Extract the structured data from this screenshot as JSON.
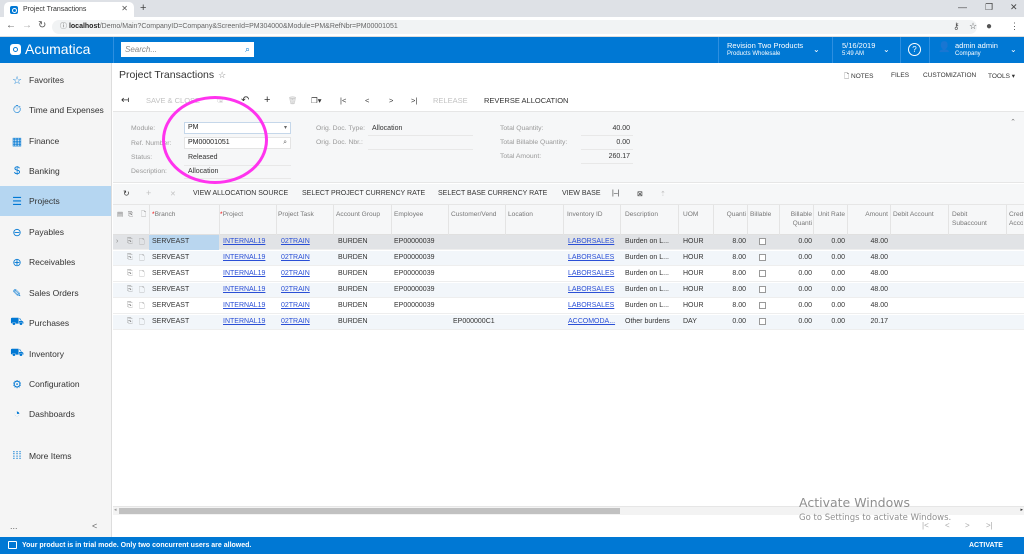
{
  "browser": {
    "tab_title": "Project Transactions",
    "url_host": "localhost",
    "url_path": "/Demo/Main?CompanyID=Company&ScreenId=PM304000&Module=PM&RefNbr=PM00001051"
  },
  "header": {
    "logo": "Acumatica",
    "search_placeholder": "Search...",
    "branch_name": "Revision Two Products",
    "branch_sub": "Products Wholesale",
    "date": "5/16/2019",
    "time": "5:49 AM",
    "user_name": "admin admin",
    "user_company": "Company"
  },
  "sidebar": {
    "items": [
      {
        "label": "Favorites",
        "icon": "star-icon"
      },
      {
        "label": "Time and Expenses",
        "icon": "stopwatch-icon"
      },
      {
        "label": "Finance",
        "icon": "calculator-icon"
      },
      {
        "label": "Banking",
        "icon": "dollar-icon"
      },
      {
        "label": "Projects",
        "icon": "projects-icon",
        "active": true
      },
      {
        "label": "Payables",
        "icon": "minus-circle-icon"
      },
      {
        "label": "Receivables",
        "icon": "plus-circle-icon"
      },
      {
        "label": "Sales Orders",
        "icon": "edit-icon"
      },
      {
        "label": "Purchases",
        "icon": "cart-icon"
      },
      {
        "label": "Inventory",
        "icon": "truck-icon"
      },
      {
        "label": "Configuration",
        "icon": "gear-icon"
      },
      {
        "label": "Dashboards",
        "icon": "gauge-icon"
      },
      {
        "label": "More Items",
        "icon": "grid-dots-icon"
      }
    ],
    "more": "...",
    "collapse": "<"
  },
  "page": {
    "title": "Project Transactions",
    "top_links": {
      "notes": "NOTES",
      "files": "FILES",
      "customization": "CUSTOMIZATION",
      "tools": "TOOLS"
    },
    "toolbar": {
      "save_close": "SAVE & CLOSE",
      "release": "RELEASE",
      "reverse_allocation": "REVERSE ALLOCATION"
    },
    "form": {
      "module_label": "Module:",
      "module_value": "PM",
      "ref_label": "Ref. Number:",
      "ref_value": "PM00001051",
      "status_label": "Status:",
      "status_value": "Released",
      "desc_label": "Description:",
      "desc_value": "Allocation",
      "orig_type_label": "Orig. Doc. Type:",
      "orig_type_value": "Allocation",
      "orig_nbr_label": "Orig. Doc. Nbr.:",
      "orig_nbr_value": "",
      "total_qty_label": "Total Quantity:",
      "total_qty_value": "40.00",
      "total_bill_qty_label": "Total Billable Quantity:",
      "total_bill_qty_value": "0.00",
      "total_amount_label": "Total Amount:",
      "total_amount_value": "260.17"
    },
    "grid_toolbar": {
      "view_alloc": "VIEW ALLOCATION SOURCE",
      "sel_proj_rate": "SELECT PROJECT CURRENCY RATE",
      "sel_base_rate": "SELECT BASE CURRENCY RATE",
      "view_base": "VIEW BASE"
    }
  },
  "grid": {
    "columns": [
      "Branch",
      "Project",
      "Project Task",
      "Account Group",
      "Employee",
      "Customer/Vend",
      "Location",
      "Inventory ID",
      "Description",
      "UOM",
      "Quanti",
      "Billable",
      "Billable Quanti",
      "Unit Rate",
      "Amount",
      "Debit Account",
      "Debit Subaccount",
      "Cred Acco"
    ],
    "rows": [
      {
        "branch": "SERVEAST",
        "project": "INTERNAL19",
        "task": "02TRAIN",
        "acct_group": "BURDEN",
        "employee": "EP00000039",
        "customer": "",
        "location": "",
        "inventory": "LABORSALES",
        "description": "Burden on L...",
        "uom": "HOUR",
        "qty": "8.00",
        "billable": false,
        "bill_qty": "0.00",
        "unit_rate": "0.00",
        "amount": "48.00"
      },
      {
        "branch": "SERVEAST",
        "project": "INTERNAL19",
        "task": "02TRAIN",
        "acct_group": "BURDEN",
        "employee": "EP00000039",
        "customer": "",
        "location": "",
        "inventory": "LABORSALES",
        "description": "Burden on L...",
        "uom": "HOUR",
        "qty": "8.00",
        "billable": false,
        "bill_qty": "0.00",
        "unit_rate": "0.00",
        "amount": "48.00"
      },
      {
        "branch": "SERVEAST",
        "project": "INTERNAL19",
        "task": "02TRAIN",
        "acct_group": "BURDEN",
        "employee": "EP00000039",
        "customer": "",
        "location": "",
        "inventory": "LABORSALES",
        "description": "Burden on L...",
        "uom": "HOUR",
        "qty": "8.00",
        "billable": false,
        "bill_qty": "0.00",
        "unit_rate": "0.00",
        "amount": "48.00"
      },
      {
        "branch": "SERVEAST",
        "project": "INTERNAL19",
        "task": "02TRAIN",
        "acct_group": "BURDEN",
        "employee": "EP00000039",
        "customer": "",
        "location": "",
        "inventory": "LABORSALES",
        "description": "Burden on L...",
        "uom": "HOUR",
        "qty": "8.00",
        "billable": false,
        "bill_qty": "0.00",
        "unit_rate": "0.00",
        "amount": "48.00"
      },
      {
        "branch": "SERVEAST",
        "project": "INTERNAL19",
        "task": "02TRAIN",
        "acct_group": "BURDEN",
        "employee": "EP00000039",
        "customer": "",
        "location": "",
        "inventory": "LABORSALES",
        "description": "Burden on L...",
        "uom": "HOUR",
        "qty": "8.00",
        "billable": false,
        "bill_qty": "0.00",
        "unit_rate": "0.00",
        "amount": "48.00"
      },
      {
        "branch": "SERVEAST",
        "project": "INTERNAL19",
        "task": "02TRAIN",
        "acct_group": "BURDEN",
        "employee": "",
        "customer": "EP000000C1",
        "location": "",
        "inventory": "ACCOMODA...",
        "description": "Other burdens",
        "uom": "DAY",
        "qty": "0.00",
        "billable": false,
        "bill_qty": "0.00",
        "unit_rate": "0.00",
        "amount": "20.17"
      }
    ]
  },
  "watermark": {
    "line1": "Activate Windows",
    "line2": "Go to Settings to activate Windows."
  },
  "footer": {
    "message": "Your product is in trial mode. Only two concurrent users are allowed.",
    "activate": "ACTIVATE"
  },
  "colors": {
    "brand": "#0078d4",
    "annotation": "#ff33ee",
    "link": "#2a4fd6"
  }
}
